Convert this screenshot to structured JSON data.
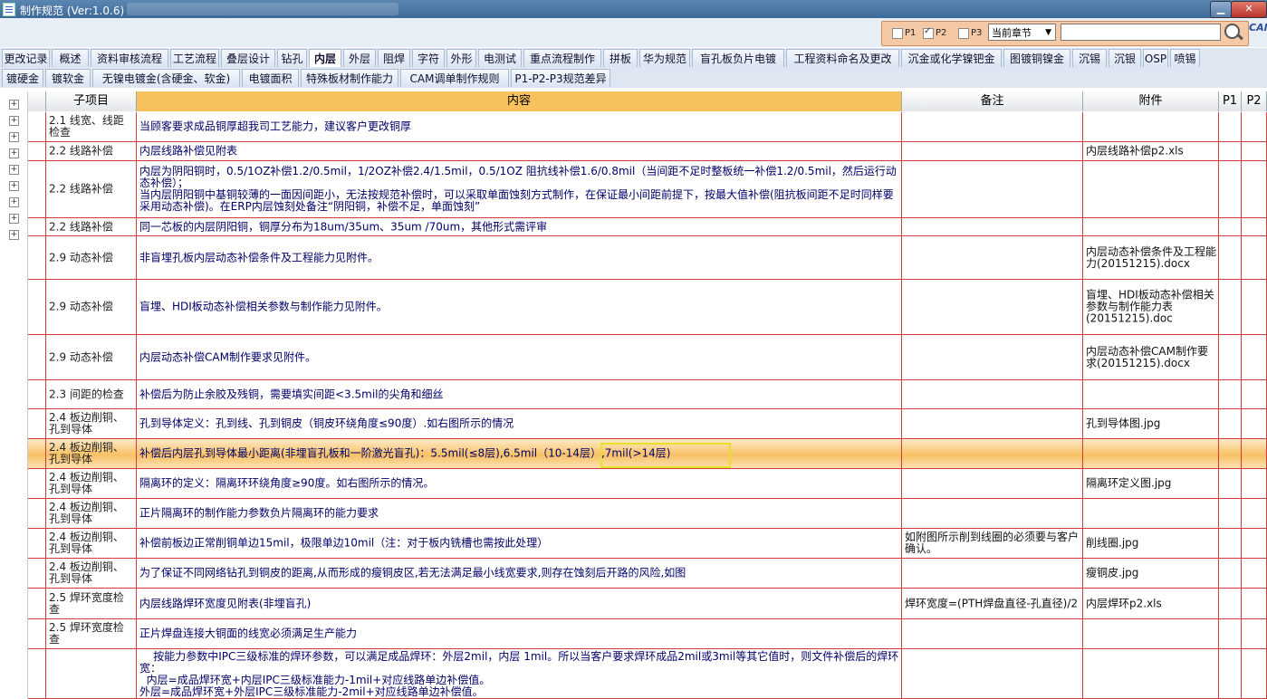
{
  "window": {
    "title": "制作规范 (Ver:1.0.6)"
  },
  "filter": {
    "p1_label": "P1",
    "p2_label": "P2",
    "p3_label": "P3",
    "p1_checked": false,
    "p2_checked": true,
    "p3_checked": false,
    "chapter_select": "当前章节",
    "search_placeholder": "",
    "logo": "CAM"
  },
  "tabs_row1": [
    "更改记录",
    "概述",
    "资料审核流程",
    "工艺流程",
    "叠层设计",
    "钻孔",
    "内层",
    "外层",
    "阻焊",
    "字符",
    "外形",
    "电测试",
    "重点流程制作",
    "拼板",
    "华为规范",
    "盲孔板负片电镀",
    "工程资料命名及更改",
    "沉金或化学镍钯金",
    "图镀铜镍金",
    "沉锡",
    "沉银",
    "OSP",
    "喷锡"
  ],
  "tabs_row2": [
    "镀硬金",
    "镀软金",
    "无镍电镀金(含硬金、软金)",
    "电镀面积",
    "特殊板材制作能力",
    "CAM调单制作规则",
    "P1-P2-P3规范差异"
  ],
  "active_tab": "内层",
  "columns": {
    "sub": "子项目",
    "content": "内容",
    "remark": "备注",
    "attachment": "附件",
    "p1": "P1",
    "p2": "P2"
  },
  "rows": [
    {
      "sub": "2.1 线宽、线距检查",
      "content": "当顾客要求成品铜厚超我司工艺能力，建议客户更改铜厚",
      "remark": "",
      "attachment": "",
      "p1": true,
      "p2": true
    },
    {
      "sub": "2.2 线路补偿",
      "content": "内层线路补偿见附表",
      "remark": "",
      "attachment": "内层线路补偿p2.xls",
      "p1": false,
      "p2": true
    },
    {
      "sub": "2.2 线路补偿",
      "content": "内层为阴阳铜时，0.5/1OZ补偿1.2/0.5mil，1/2OZ补偿2.4/1.5mil，0.5/1OZ 阻抗线补偿1.6/0.8mil（当间距不足时整板统一补偿1.2/0.5mil，然后运行动态补偿）；\n当内层阴阳铜中基铜较薄的一面因间距小，无法按规范补偿时，可以采取单面蚀刻方式制作，在保证最小间距前提下，按最大值补偿(阻抗板间距不足时同样要采用动态补偿)。在ERP内层蚀刻处备注“阴阳铜，补偿不足，单面蚀刻”",
      "remark": "",
      "attachment": "",
      "p1": false,
      "p2": true
    },
    {
      "sub": "2.2 线路补偿",
      "content": "同一芯板的内层阴阳铜，铜厚分布为18um/35um、35um /70um，其他形式需评审",
      "remark": "",
      "attachment": "",
      "p1": true,
      "p2": true
    },
    {
      "sub": "2.9 动态补偿",
      "content": "非盲埋孔板内层动态补偿条件及工程能力见附件。",
      "remark": "",
      "attachment": "内层动态补偿条件及工程能力(20151215).docx",
      "p1": false,
      "p2": true
    },
    {
      "sub": "2.9 动态补偿",
      "content": "盲埋、HDI板动态补偿相关参数与制作能力见附件。",
      "remark": "",
      "attachment": "盲埋、HDI板动态补偿相关参数与制作能力表(20151215).doc",
      "p1": false,
      "p2": true
    },
    {
      "sub": "2.9 动态补偿",
      "content": "内层动态补偿CAM制作要求见附件。",
      "remark": "",
      "attachment": "内层动态补偿CAM制作要求(20151215).docx",
      "p1": false,
      "p2": true
    },
    {
      "sub": "2.3 间距的检查",
      "content": "补偿后为防止余胶及残铜，需要填实间距<3.5mil的尖角和细丝",
      "remark": "",
      "attachment": "",
      "p1": true,
      "p2": true
    },
    {
      "sub": "2.4 板边削铜、孔到导体",
      "content": "孔到导体定义：孔到线、孔到铜皮（铜皮环绕角度≤90度）.如右图所示的情况",
      "remark": "",
      "attachment": "孔到导体图.jpg",
      "p1": true,
      "p2": true
    },
    {
      "sub": "2.4 板边削铜、孔到导体",
      "content": "补偿后内层孔到导体最小距离(非埋盲孔板和一阶激光盲孔)：5.5mil(≤8层),6.5mil（10-14层）,7mil(>14层)",
      "remark": "",
      "attachment": "",
      "p1": false,
      "p2": true,
      "selected": true
    },
    {
      "sub": "2.4 板边削铜、孔到导体",
      "content": "隔离环的定义：隔离环环绕角度≥90度。如右图所示的情况。",
      "remark": "",
      "attachment": "隔离环定义图.jpg",
      "p1": true,
      "p2": true
    },
    {
      "sub": "2.4 板边削铜、孔到导体",
      "content": "正片隔离环的制作能力参数负片隔离环的能力要求",
      "remark": "",
      "attachment": "",
      "p1": true,
      "p2": true
    },
    {
      "sub": "2.4 板边削铜、孔到导体",
      "content": "补偿前板边正常削铜单边15mil，极限单边10mil（注：对于板内铣槽也需按此处理）",
      "remark": "如附图所示削到线圈的必须要与客户确认。",
      "attachment": "削线圈.jpg",
      "p1": true,
      "p2": true
    },
    {
      "sub": "2.4 板边削铜、孔到导体",
      "content": "为了保证不同网络钻孔到铜皮的距离,从而形成的瘦铜皮区,若无法满足最小线宽要求,则存在蚀刻后开路的风险,如图",
      "remark": "",
      "attachment": "瘦铜皮.jpg",
      "p1": true,
      "p2": true
    },
    {
      "sub": "2.5 焊环宽度检查",
      "content": "内层线路焊环宽度见附表(非埋盲孔)",
      "remark": "焊环宽度=(PTH焊盘直径-孔直径)/2",
      "attachment": "内层焊环p2.xls",
      "p1": false,
      "p2": true
    },
    {
      "sub": "2.5 焊环宽度检查",
      "content": "正片焊盘连接大铜面的线宽必须满足生产能力",
      "remark": "",
      "attachment": "",
      "p1": true,
      "p2": true
    },
    {
      "sub": "",
      "content": "    按能力参数中IPC三级标准的焊环参数，可以满足成品焊环：外层2mil，内层 1mil。所以当客户要求焊环成品2mil或3mil等其它值时，则文件补偿后的焊环宽：\n  内层=成品焊环宽+内层IPC三级标准能力-1mil+对应线路单边补偿值。\n外层=成品焊环宽+外层IPC三级标准能力-2mil+对应线路单边补偿值。",
      "remark": "",
      "attachment": "",
      "p1": false,
      "p2": false
    }
  ]
}
